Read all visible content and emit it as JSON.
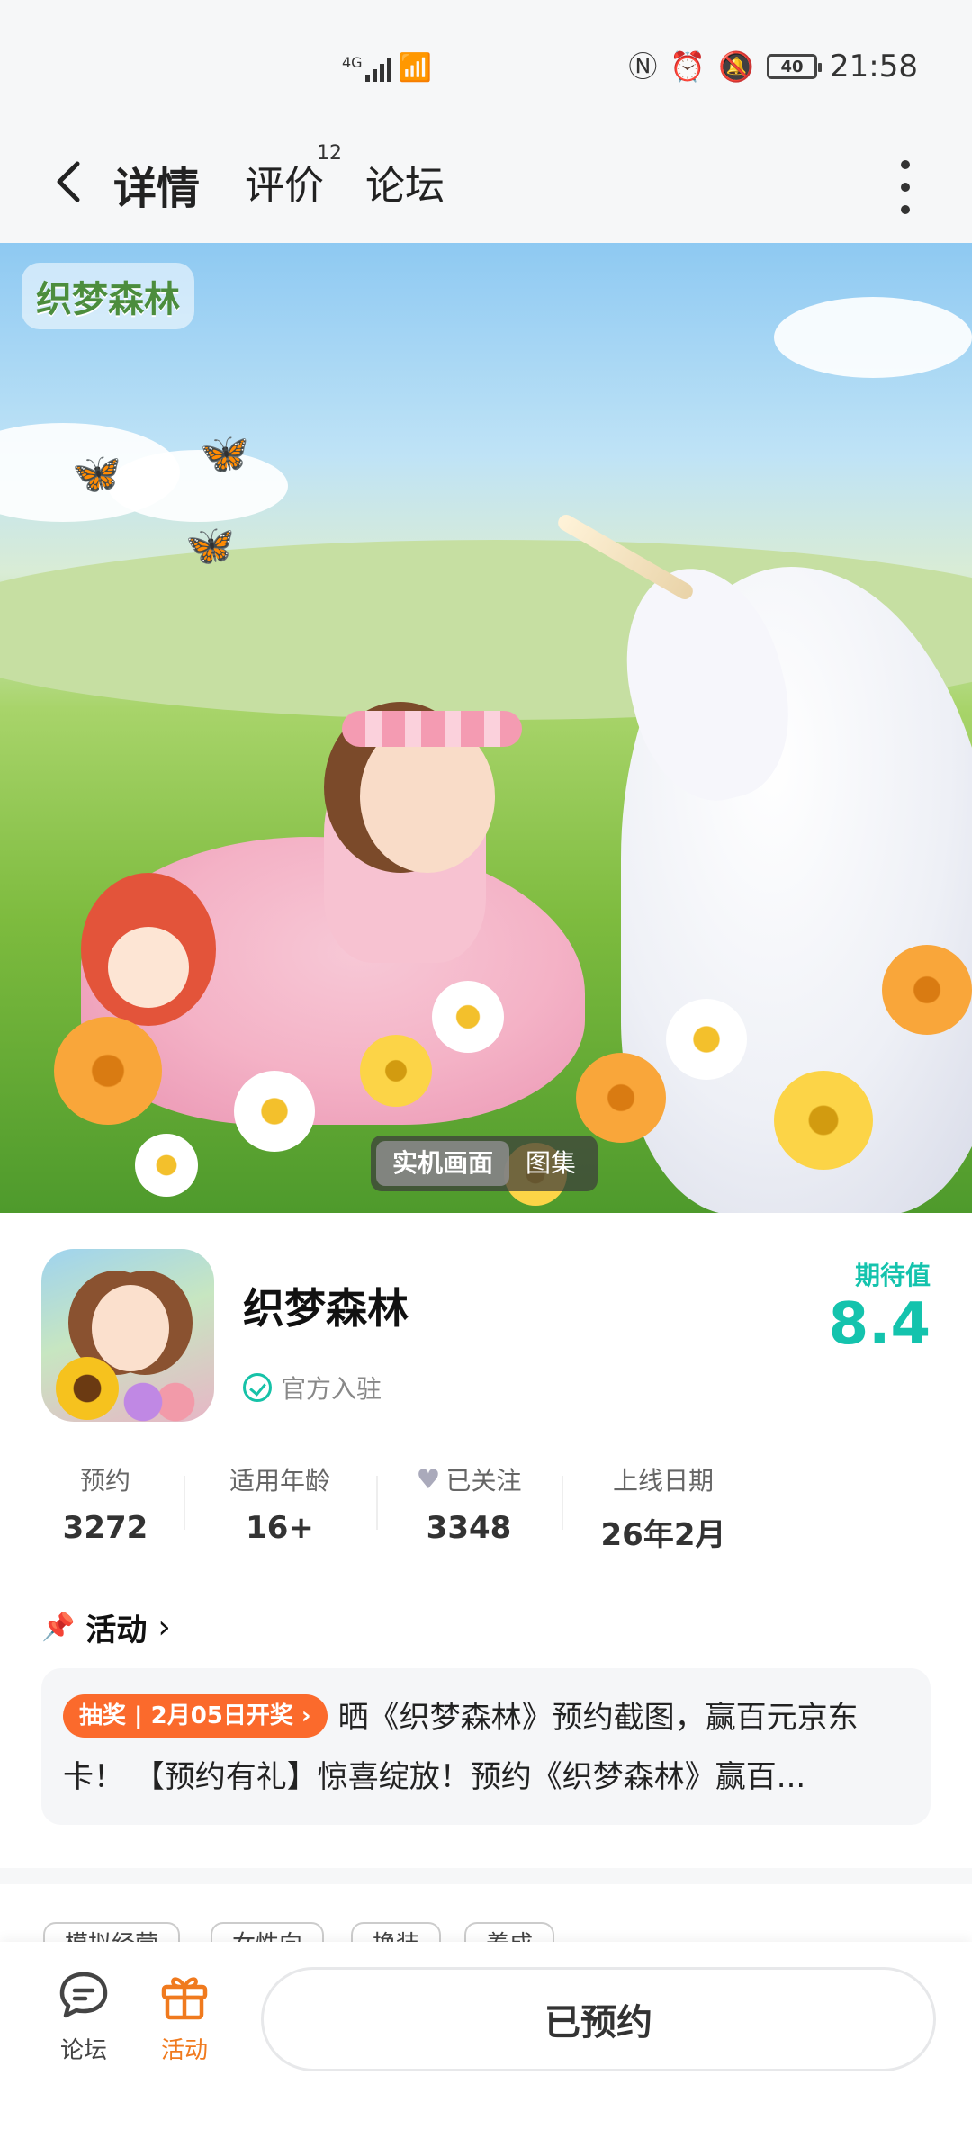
{
  "status_bar": {
    "network": "4G",
    "wifi": "6",
    "battery": "40",
    "time": "21:58"
  },
  "header": {
    "tabs": [
      {
        "label": "详情",
        "active": true
      },
      {
        "label": "评价",
        "count": "12"
      },
      {
        "label": "论坛"
      }
    ]
  },
  "hero": {
    "logo_text": "织梦森林",
    "media_options": [
      "实机画面",
      "图集"
    ],
    "active_media": "实机画面"
  },
  "app": {
    "name": "织梦森林",
    "official_label": "官方入驻",
    "expect_label": "期待值",
    "expect_value": "8.4"
  },
  "stats": [
    {
      "label": "预约",
      "value": "3272"
    },
    {
      "label": "适用年龄",
      "value": "16+"
    },
    {
      "label": "已关注",
      "value": "3348"
    },
    {
      "label": "上线日期",
      "value": "26年2月"
    }
  ],
  "activity": {
    "title": "活动",
    "badge": "抽奖 | 2月05日开奖 ›",
    "text": "晒《织梦森林》预约截图，赢百元京东卡！ 【预约有礼】惊喜绽放！预约《织梦森林》赢百..."
  },
  "tags": [
    "模拟经营",
    "女性向",
    "换装",
    "养成"
  ],
  "bottom_bar": {
    "forum_label": "论坛",
    "activity_label": "活动",
    "reserved_label": "已预约"
  },
  "colors": {
    "accent_teal": "#16d1b9",
    "activity_orange": "#f07a1e",
    "badge_orange": "#fb6a2c"
  }
}
